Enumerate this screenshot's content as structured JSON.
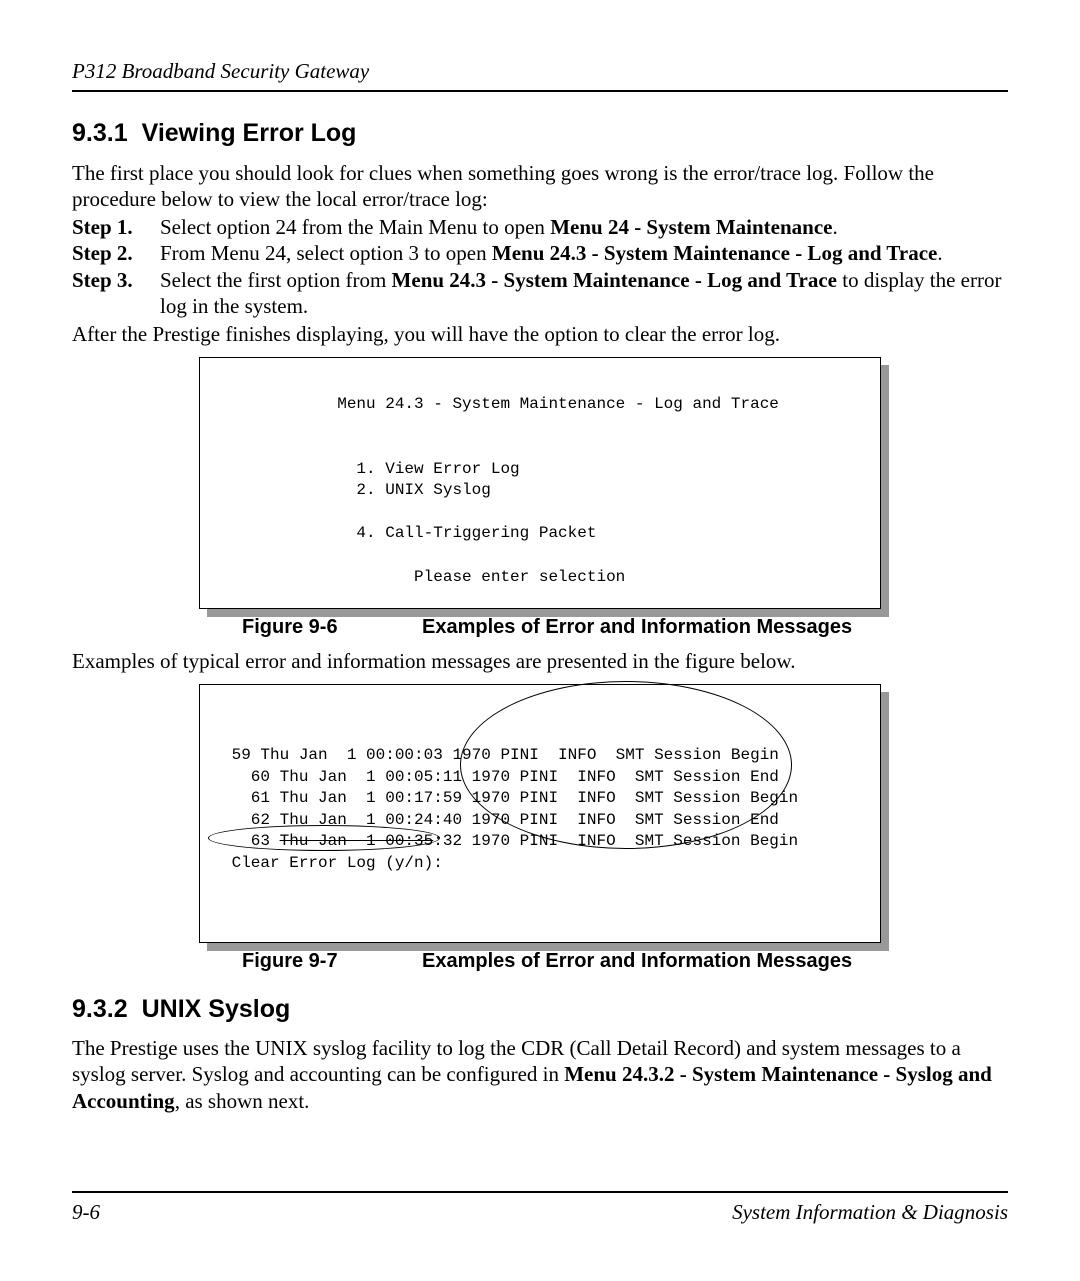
{
  "header": {
    "title": "P312  Broadband Security Gateway"
  },
  "section1": {
    "number": "9.3.1",
    "title": "Viewing Error Log",
    "intro": "The first place you should look for clues when something goes wrong is the error/trace log. Follow the procedure below to view the local error/trace log:",
    "steps": [
      {
        "label": "Step 1.",
        "pre": "Select option 24 from the Main Menu to open ",
        "bold1": "Menu 24 - System Maintenance",
        "post": "."
      },
      {
        "label": "Step 2.",
        "pre": "From Menu 24, select option 3 to open ",
        "bold1": "Menu 24.3 - System Maintenance - Log and Trace",
        "post": "."
      },
      {
        "label": "Step 3.",
        "pre": "Select the first option from ",
        "bold1": "Menu 24.3 - System Maintenance - Log and Trace",
        "post": " to display the error log in the system."
      }
    ],
    "after_steps": " After the Prestige finishes displaying, you will have the option to clear the error log."
  },
  "figure6": {
    "menu_title": "            Menu 24.3 - System Maintenance - Log and Trace",
    "opt1": "              1. View Error Log",
    "opt2": "              2. UNIX Syslog",
    "opt4": "              4. Call-Triggering Packet",
    "prompt": "                    Please enter selection",
    "caption_num": "Figure 9-6",
    "caption_text": "Examples of Error and Information Messages"
  },
  "between_figs": "Examples of typical error and information messages are presented in the figure below.",
  "figure7": {
    "line1": " 59 Thu Jan  1 00:00:03 1970 PINI  INFO  SMT Session Begin",
    "line2": "   60 Thu Jan  1 00:05:11 1970 PINI  INFO  SMT Session End",
    "line3": "   61 Thu Jan  1 00:17:59 1970 PINI  INFO  SMT Session Begin",
    "line4": "   62 Thu Jan  1 00:24:40 1970 PINI  INFO  SMT Session End",
    "line5a": "   63 ",
    "line5b": "Thu Jan  1 00:35",
    "line5c": ":32 1970 PINI  INFO  SMT Session Begin",
    "line6": " Clear Error Log (y/n):",
    "caption_num": "Figure 9-7",
    "caption_text": "Examples of Error and Information Messages"
  },
  "section2": {
    "number": "9.3.2",
    "title": "UNIX Syslog",
    "para_pre": " The Prestige uses the UNIX syslog facility to log the CDR (Call Detail Record) and system messages to a syslog server. Syslog and accounting can be configured in ",
    "para_bold": "Menu 24.3.2 - System Maintenance - Syslog and Accounting",
    "para_post": ", as shown next."
  },
  "footer": {
    "page": "9-6",
    "section": "System Information & Diagnosis"
  }
}
